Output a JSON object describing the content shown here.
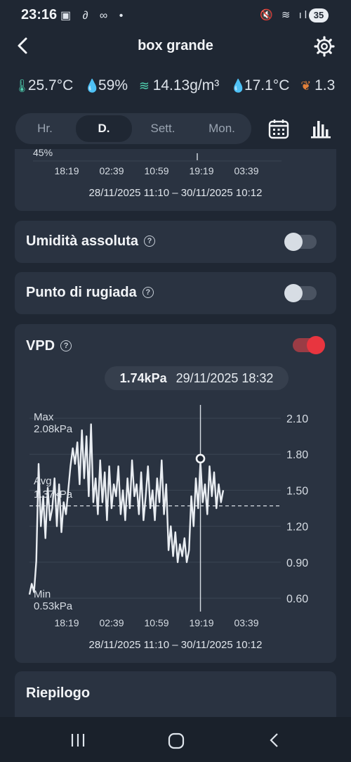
{
  "status": {
    "time": "23:16",
    "left_icons": "▣ ∂ ∞ •",
    "right_icons": "🔇 ≋ ıl",
    "battery": "35"
  },
  "header": {
    "title": "box grande"
  },
  "readings": [
    {
      "icon": "thermometer-icon",
      "value": "25.7°C"
    },
    {
      "icon": "drop-icon",
      "value": "59%"
    },
    {
      "icon": "absolute-humidity-icon",
      "value": "14.13g/m³"
    },
    {
      "icon": "dew-point-icon",
      "value": "17.1°C"
    },
    {
      "icon": "leaf-icon",
      "value": "1.3"
    }
  ],
  "tabs": [
    "Hr.",
    "D.",
    "Sett.",
    "Mon."
  ],
  "active_tab": "D.",
  "top_card": {
    "partial_label": "45%",
    "x_ticks": [
      "18:19",
      "02:39",
      "10:59",
      "19:19",
      "03:39"
    ],
    "range": "28/11/2025 11:10 – 30/11/2025 10:12"
  },
  "abs_humidity": {
    "label": "Umidità assoluta",
    "enabled": false
  },
  "dew_point": {
    "label": "Punto di rugiada",
    "enabled": false
  },
  "vpd": {
    "label": "VPD",
    "enabled": true,
    "tooltip_value": "1.74kPa",
    "tooltip_time": "29/11/2025 18:32",
    "range": "28/11/2025 11:10 – 30/11/2025 10:12"
  },
  "summary": {
    "label": "Riepilogo"
  },
  "colors": {
    "accent_on": "#e8353f",
    "background": "#1f2733",
    "card": "#2a3341"
  },
  "chart_data": {
    "type": "line",
    "title": "VPD",
    "x_ticks": [
      "18:19",
      "02:39",
      "10:59",
      "19:19",
      "03:39"
    ],
    "y_ticks": [
      "2.10",
      "1.80",
      "1.50",
      "1.20",
      "0.90",
      "0.60"
    ],
    "ylim": [
      0.5,
      2.2
    ],
    "max_label": "Max",
    "max_value": "2.08kPa",
    "avg_label": "Avg",
    "avg_value": "1.37kPa",
    "min_label": "Min",
    "min_value": "0.53kPa",
    "avg": 1.37,
    "selected_index": 75,
    "series": [
      {
        "values": [
          0.63,
          0.72,
          0.65,
          0.91,
          1.72,
          1.2,
          1.45,
          1.1,
          1.52,
          1.25,
          1.35,
          1.6,
          1.2,
          1.55,
          1.15,
          1.4,
          1.3,
          1.5,
          1.7,
          1.85,
          1.72,
          1.9,
          1.55,
          2.0,
          1.6,
          1.95,
          1.45,
          2.05,
          1.4,
          1.6,
          1.3,
          1.75,
          1.4,
          1.65,
          1.25,
          1.7,
          1.35,
          1.55,
          1.45,
          1.7,
          1.3,
          1.5,
          1.25,
          1.6,
          1.35,
          1.75,
          1.45,
          1.55,
          1.3,
          1.65,
          1.25,
          1.45,
          1.7,
          1.35,
          1.5,
          1.25,
          1.6,
          1.4,
          1.75,
          1.3,
          1.55,
          1.0,
          1.2,
          0.95,
          1.15,
          0.9,
          1.05,
          0.95,
          1.1,
          0.9,
          1.0,
          1.45,
          1.2,
          1.6,
          1.35,
          1.74,
          1.4,
          1.55,
          1.3,
          1.7,
          1.45,
          1.65,
          1.35,
          1.55,
          1.4,
          1.5
        ]
      }
    ]
  }
}
